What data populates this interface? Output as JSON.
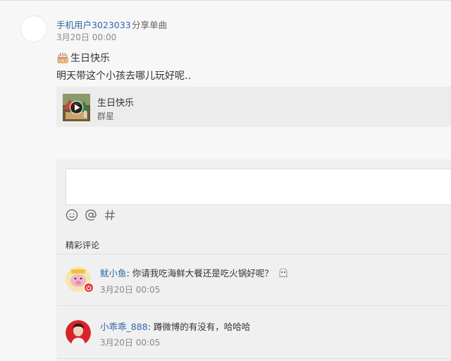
{
  "post": {
    "username": "手机用户3023033",
    "action": "分享单曲",
    "time": "3月20日 00:00",
    "line1": "生日快乐",
    "line2": "明天带这个小孩去哪儿玩好呢..",
    "line1_icon": "birthday-cake-emoji"
  },
  "song": {
    "title": "生日快乐",
    "artist": "群星",
    "cover_icon": "album-cover-with-play-icon"
  },
  "comments_section": {
    "title": "精彩评论",
    "tools": [
      "emoji-icon",
      "at-icon",
      "hashtag-icon"
    ],
    "items": [
      {
        "user": "鱿小鱼",
        "separator": ":",
        "text": " 你请我吃海鲜大餐还是吃火锅好呢？",
        "time": "3月20日 00:05",
        "avatar_icon": "cartoon-pig-avatar",
        "emoji_icon": "ghost-emoji"
      },
      {
        "user": "小乖乖_888",
        "separator": ":",
        "text": " 蹲微博的有没有，哈哈哈",
        "time": "3月20日 00:05",
        "avatar_icon": "photo-avatar"
      }
    ]
  },
  "colors": {
    "link": "#2e67a6",
    "background": "#f7f7f7",
    "panel": "#f0f0f0"
  }
}
